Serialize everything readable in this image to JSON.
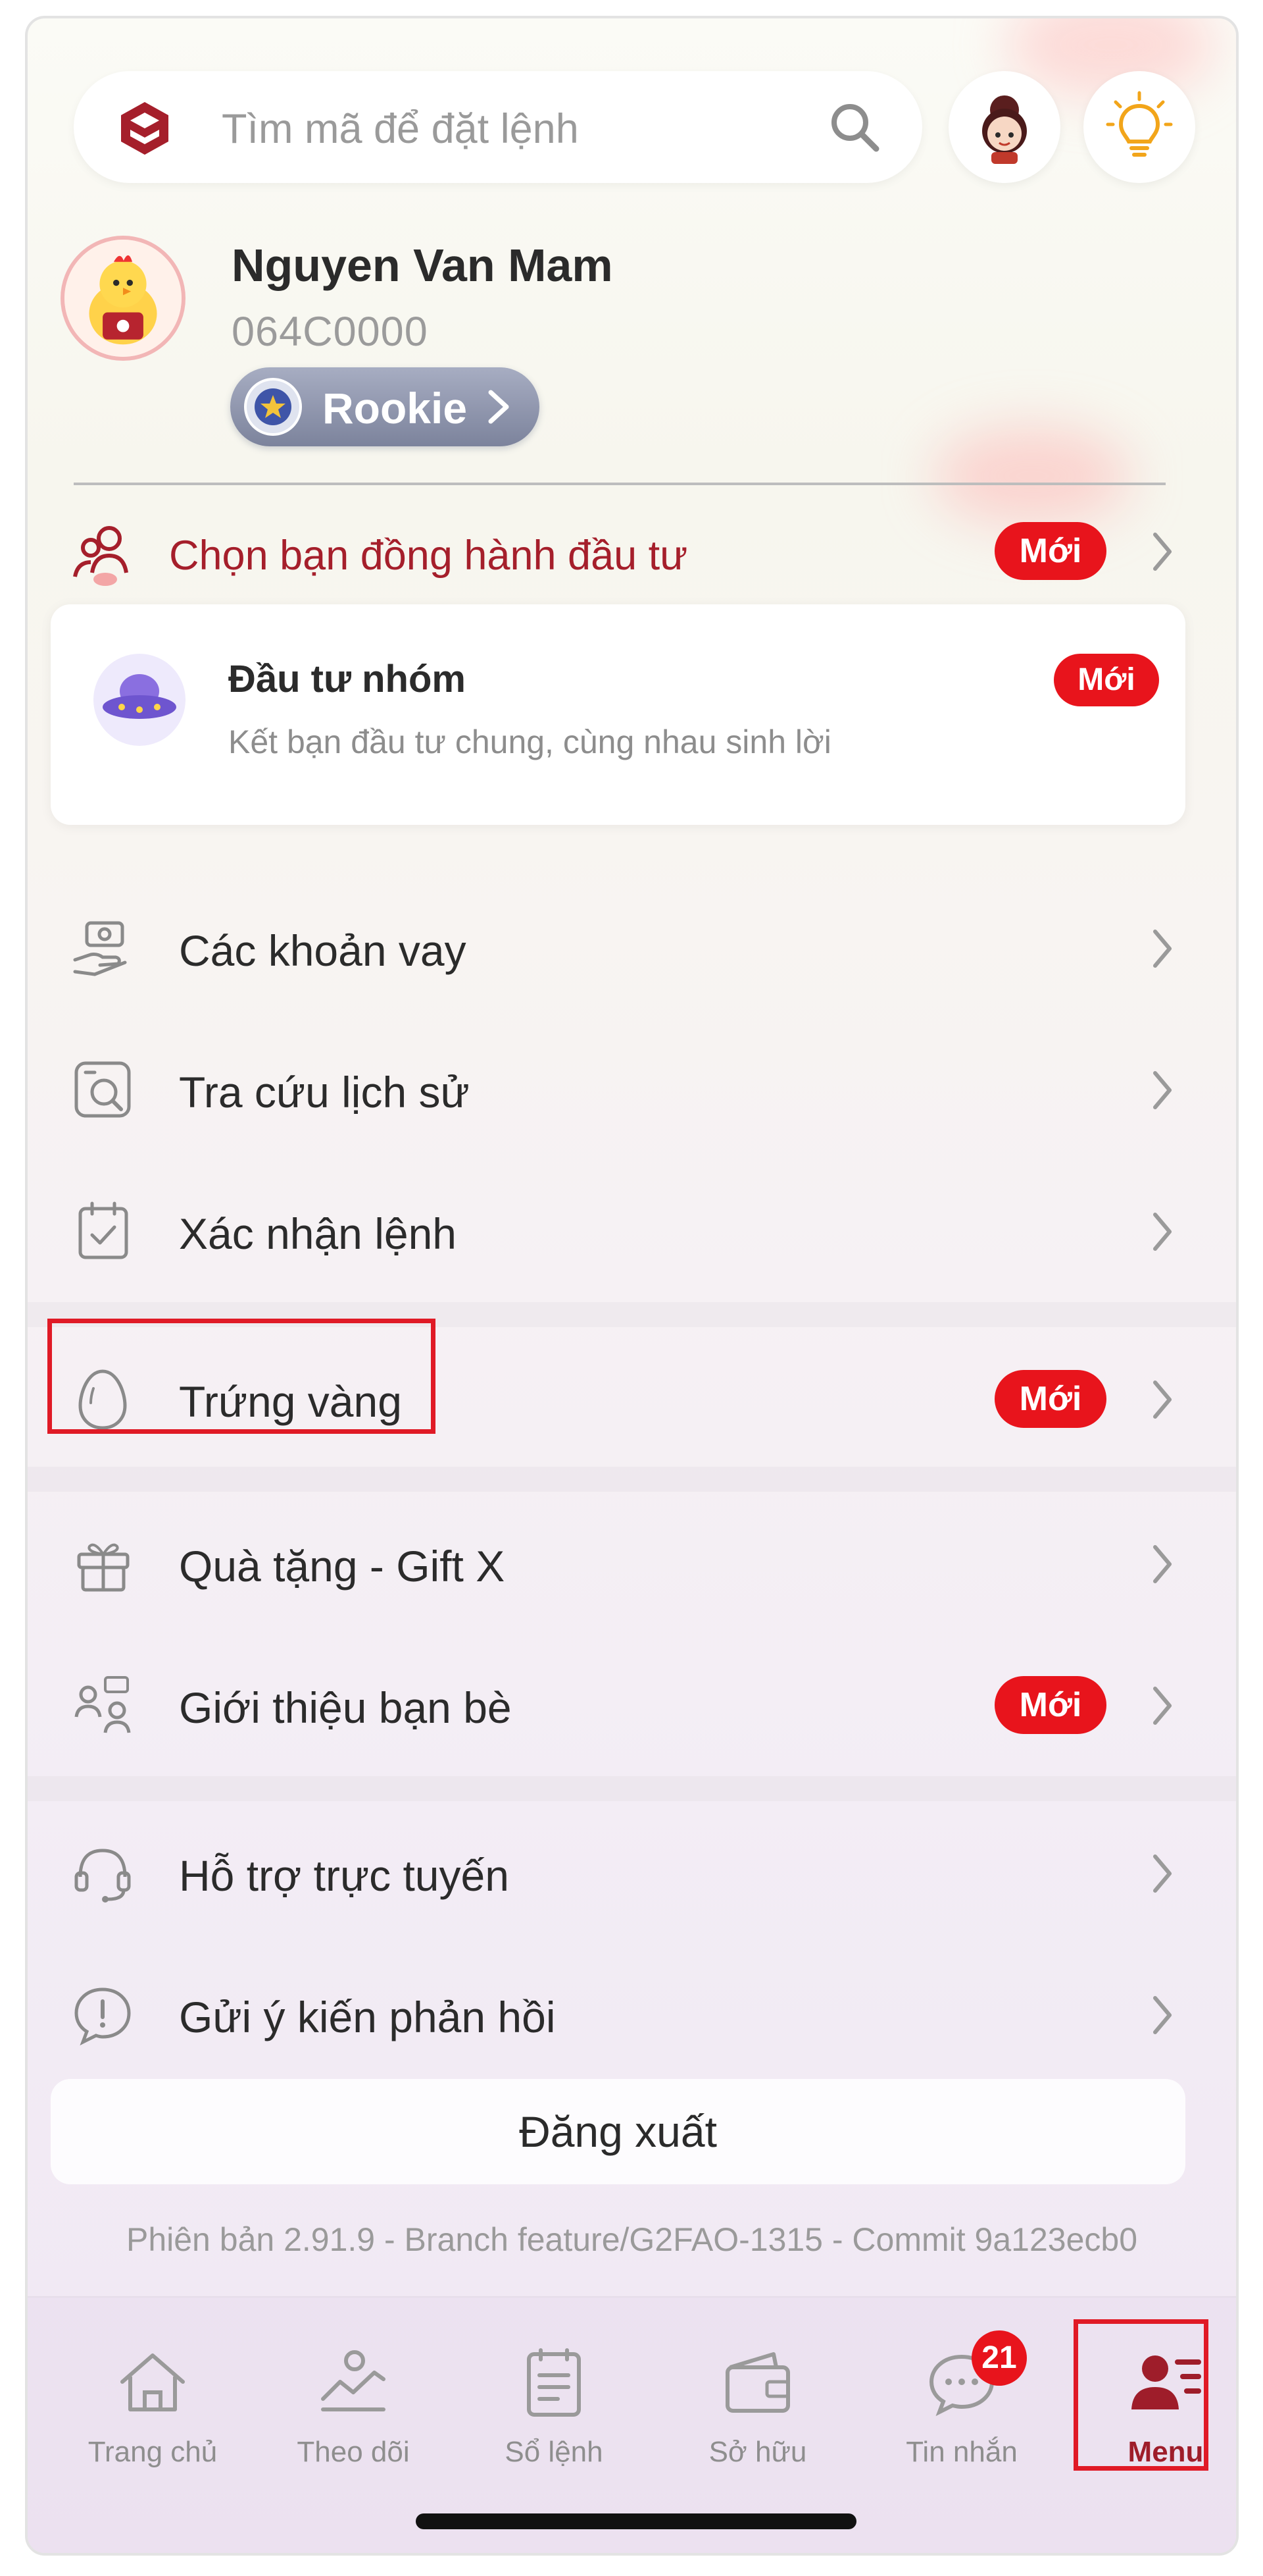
{
  "search": {
    "placeholder": "Tìm mã để đặt lệnh"
  },
  "profile": {
    "name": "Nguyen Van Mam",
    "account": "064C0000",
    "rank": "Rookie"
  },
  "companion": {
    "label": "Chọn bạn đồng hành đầu tư",
    "badge": "Mới"
  },
  "group_invest": {
    "title": "Đầu tư nhóm",
    "subtitle": "Kết bạn đầu tư chung, cùng nhau sinh lời",
    "badge": "Mới"
  },
  "menu": {
    "section1": [
      {
        "label": "Các khoản vay",
        "icon": "loan-hand-icon"
      },
      {
        "label": "Tra cứu lịch sử",
        "icon": "history-search-icon"
      },
      {
        "label": "Xác nhận lệnh",
        "icon": "order-confirm-icon"
      }
    ],
    "section2": [
      {
        "label": "Trứng vàng",
        "icon": "egg-icon",
        "badge": "Mới"
      }
    ],
    "section3": [
      {
        "label": "Quà tặng - Gift X",
        "icon": "gift-icon"
      },
      {
        "label": "Giới thiệu bạn bè",
        "icon": "refer-friends-icon",
        "badge": "Mới"
      }
    ],
    "section4": [
      {
        "label": "Hỗ trợ trực tuyến",
        "icon": "headset-icon"
      },
      {
        "label": "Gửi ý kiến phản hồi",
        "icon": "feedback-icon"
      }
    ]
  },
  "logout_label": "Đăng xuất",
  "version": "Phiên bản 2.91.9 - Branch feature/G2FAO-1315 - Commit 9a123ecb0",
  "bottom_nav": [
    {
      "label": "Trang chủ",
      "icon": "home-icon"
    },
    {
      "label": "Theo dõi",
      "icon": "watchlist-icon"
    },
    {
      "label": "Sổ lệnh",
      "icon": "order-book-icon"
    },
    {
      "label": "Sở hữu",
      "icon": "wallet-icon"
    },
    {
      "label": "Tin nhắn",
      "icon": "chat-icon",
      "badge": "21"
    },
    {
      "label": "Menu",
      "icon": "menu-user-icon",
      "active": true
    }
  ],
  "colors": {
    "brand": "#a51f2b",
    "badge": "#e8141c",
    "highlight": "#e01a26"
  }
}
